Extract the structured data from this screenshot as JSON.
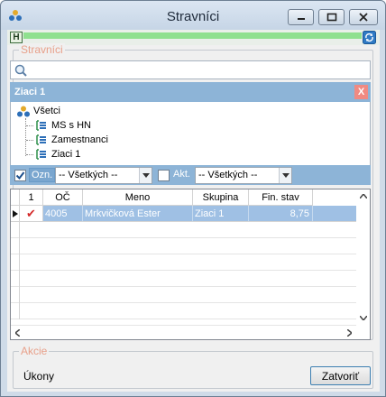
{
  "window": {
    "title": "Stravníci"
  },
  "toolbar": {
    "h_label": "H"
  },
  "stravnici_group": {
    "label": "Stravníci"
  },
  "search": {
    "value": "",
    "placeholder": ""
  },
  "selected_group": {
    "title": "Ziaci 1",
    "close_label": "X"
  },
  "tree": {
    "root": "Všetci",
    "children": [
      "MS s HN",
      "Zamestnanci",
      "Ziaci 1"
    ]
  },
  "filter": {
    "ozn_label": "Ozn.",
    "ozn_checked": true,
    "ozn_combo_value": "-- Všetkých --",
    "akt_label": "Akt.",
    "akt_checked": false,
    "akt_combo_value": "-- Všetkých --"
  },
  "grid": {
    "columns": [
      "1",
      "OČ",
      "Meno",
      "Skupina",
      "Fin. stav"
    ],
    "rows": [
      {
        "mark": "✔",
        "oc": "4005",
        "meno": "Mrkvičková Ester",
        "skupina": "Ziaci 1",
        "fin_stav": "8,75"
      }
    ]
  },
  "akcie_group": {
    "label": "Akcie",
    "ukony_label": "Úkony"
  },
  "buttons": {
    "close_label": "Zatvoriť"
  },
  "colors": {
    "accent": "#8db4d7",
    "selection": "#9fc0e4",
    "group_label": "#e8a08a",
    "green_bar": "#8fe08f"
  }
}
